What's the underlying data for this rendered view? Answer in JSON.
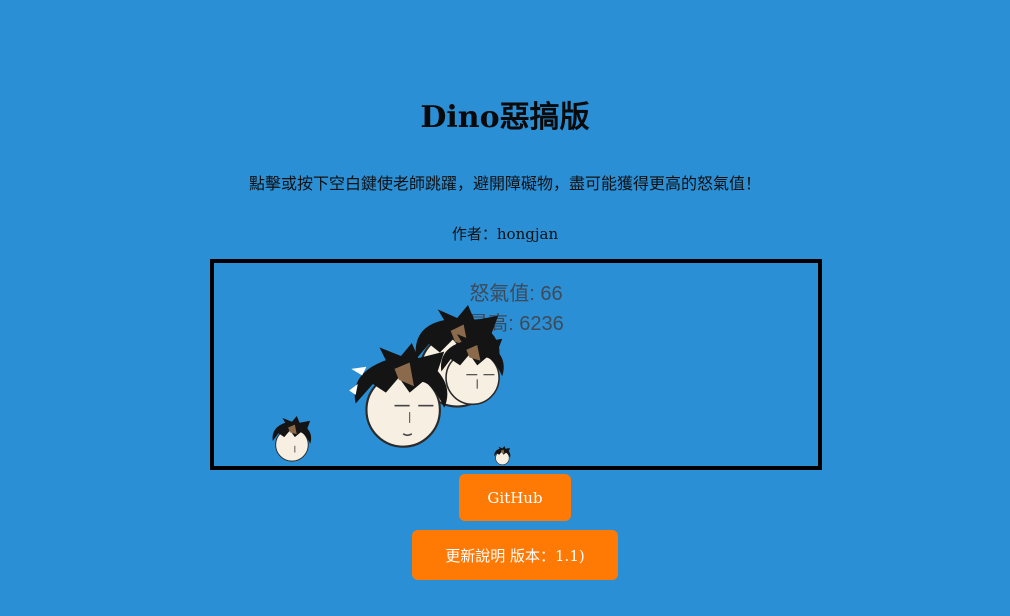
{
  "header": {
    "title": "Dino惡搞版",
    "instructions": "點擊或按下空白鍵使老師跳躍，避開障礙物，盡可能獲得更高的怒氣值！",
    "author": "作者：hongjan"
  },
  "game": {
    "rage_label": "怒氣值: 66",
    "best_label": "最高: 6236",
    "border_color": "#000000",
    "sprites": [
      "teacher-head-icon",
      "teacher-head-icon",
      "teacher-head-icon",
      "teacher-head-icon",
      "teacher-head-icon"
    ]
  },
  "buttons": {
    "github": "GitHub",
    "update": "更新說明 版本：1.1)"
  },
  "colors": {
    "background": "#2b8fd6",
    "button": "#ff7a05"
  }
}
